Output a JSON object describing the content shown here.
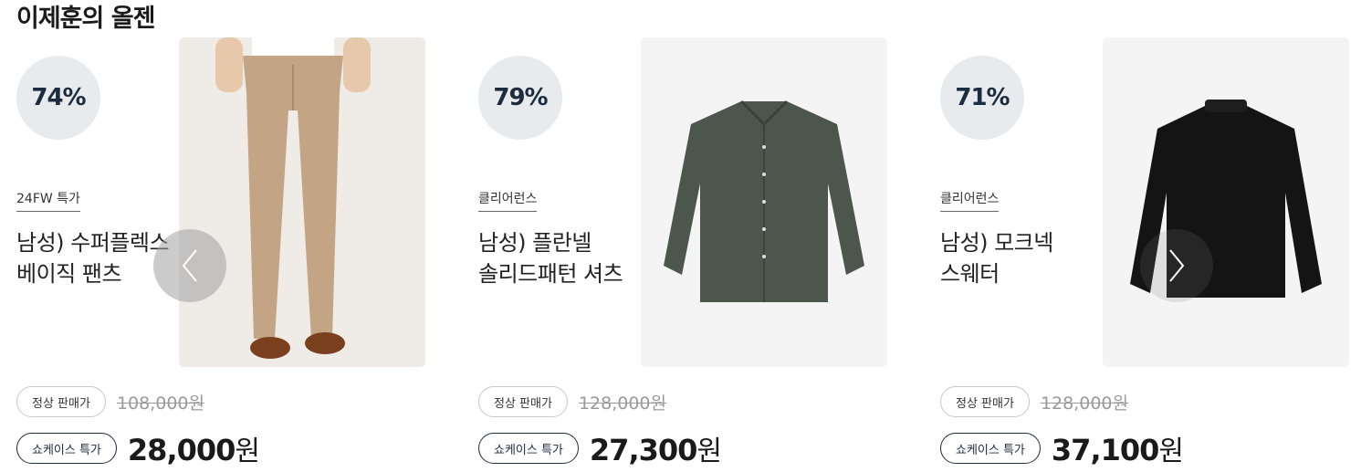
{
  "section": {
    "title": "이제훈의 올젠"
  },
  "labels": {
    "regular": "정상 판매가",
    "special": "쇼케이스 특가",
    "won": "원"
  },
  "products": [
    {
      "discount": "74%",
      "tag": "24FW 특가",
      "name_line1": "남성) 수퍼플렉스",
      "name_line2": "베이직 팬츠",
      "regular_price": "108,000원",
      "sale_price": "28,000",
      "image": "beige-pants-image"
    },
    {
      "discount": "79%",
      "tag": "클리어런스",
      "name_line1": "남성) 플란넬",
      "name_line2": "솔리드패턴 셔츠",
      "regular_price": "128,000원",
      "sale_price": "27,300",
      "image": "green-flannel-shirt-image"
    },
    {
      "discount": "71%",
      "tag": "클리어런스",
      "name_line1": "남성) 모크넥",
      "name_line2": "스웨터",
      "regular_price": "128,000원",
      "sale_price": "37,100",
      "image": "black-mockneck-sweater-image"
    }
  ],
  "icons": {
    "prev": "chevron-left-icon",
    "next": "chevron-right-icon"
  },
  "colors": {
    "accent": "#1c2b3e",
    "badge_bg": "#e7ebee"
  }
}
